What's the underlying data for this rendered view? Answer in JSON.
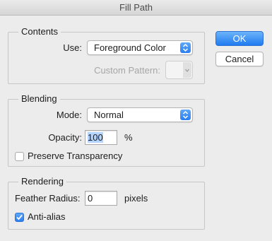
{
  "window": {
    "title": "Fill Path"
  },
  "contents": {
    "title": "Contents",
    "use_label": "Use:",
    "use_value": "Foreground Color",
    "custom_pattern_label": "Custom Pattern:"
  },
  "blending": {
    "title": "Blending",
    "mode_label": "Mode:",
    "mode_value": "Normal",
    "opacity_label": "Opacity:",
    "opacity_value": "100",
    "opacity_unit": "%",
    "preserve_transparency_label": "Preserve Transparency",
    "preserve_transparency_checked": false
  },
  "rendering": {
    "title": "Rendering",
    "feather_label": "Feather Radius:",
    "feather_value": "0",
    "feather_unit": "pixels",
    "antialias_label": "Anti-alias",
    "antialias_checked": true
  },
  "buttons": {
    "ok": "OK",
    "cancel": "Cancel"
  },
  "colors": {
    "accent": "#2a7ef0",
    "background": "#ececec"
  }
}
